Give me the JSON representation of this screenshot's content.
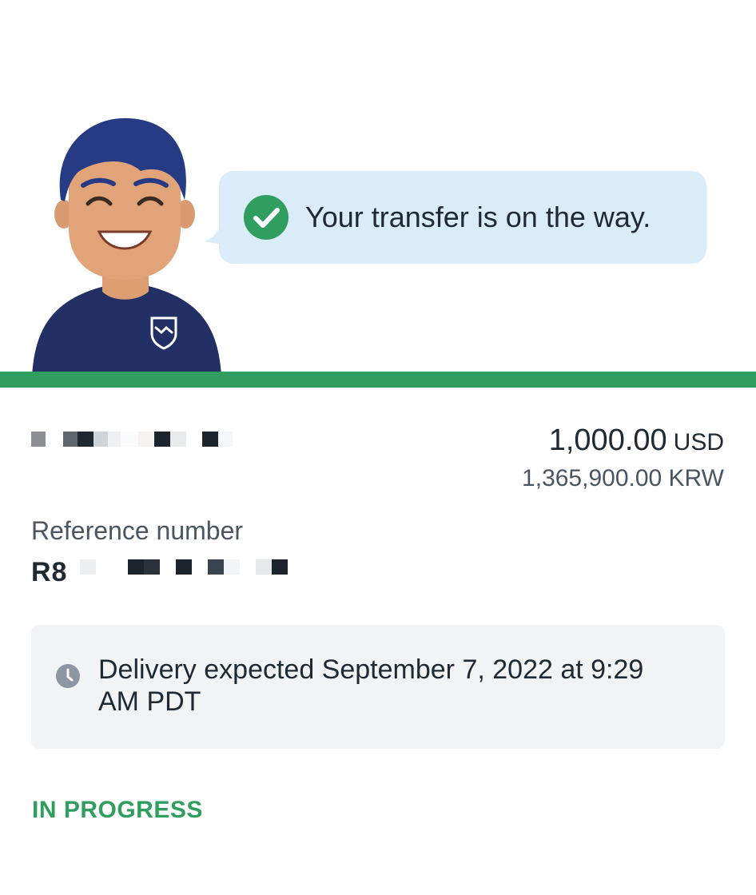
{
  "hero": {
    "message": "Your transfer is on the way.",
    "check_icon": "check-circle-icon",
    "avatar_icon": "support-agent-avatar",
    "shirt_logo_icon": "handshake-shield-icon"
  },
  "transfer": {
    "amount_value": "1,000.00",
    "amount_currency": "USD",
    "converted_amount": "1,365,900.00 KRW"
  },
  "reference": {
    "label": "Reference number",
    "value_prefix": "R8"
  },
  "delivery": {
    "icon": "clock-icon",
    "text": "Delivery expected September 7, 2022 at 9:29 AM PDT"
  },
  "status": {
    "label": "IN PROGRESS"
  },
  "colors": {
    "accent_green": "#2f9e5f",
    "bubble_bg": "#d9ecf8",
    "card_bg": "#f1f3f5",
    "avatar_navy": "#233066",
    "avatar_hair": "#273a84",
    "skin": "#e0a478"
  }
}
